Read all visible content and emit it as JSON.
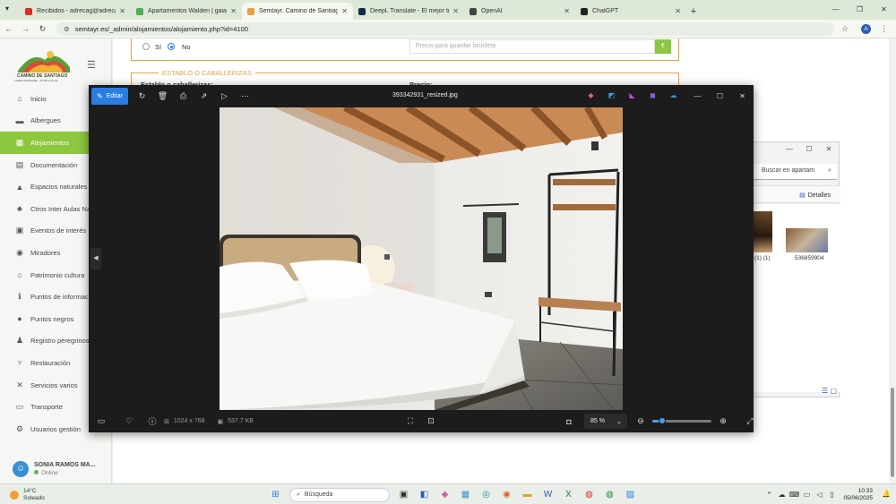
{
  "browser": {
    "tabs": [
      {
        "title": "Recibidos - adrecag@adrecag...",
        "favicon_color": "#d93025",
        "active": false
      },
      {
        "title": "Apartamentos Walden | gaiarec...",
        "favicon_color": "#4caf50",
        "active": false
      },
      {
        "title": "Semtayr. Camino de Santiago. I...",
        "favicon_color": "#e6a23c",
        "active": true
      },
      {
        "title": "DeepL Translate - El mejor tradu...",
        "favicon_color": "#0f2b46",
        "active": false
      },
      {
        "title": "OpenAI",
        "favicon_color": "#444444",
        "active": false
      },
      {
        "title": "ChatGPT",
        "favicon_color": "#222222",
        "active": false
      }
    ],
    "url": "semtayr.es/_admin/alojamientos/alojamiento.php?id=4100",
    "profile_initial": "A"
  },
  "sidebar": {
    "logo_text": "CAMINO DE SANTIAGO",
    "logo_subtext": "CAMINO MOZÁRABE · VÍA DE LA PLATA",
    "items": [
      {
        "label": "Inicio",
        "icon": "home-icon",
        "glyph": "⌂"
      },
      {
        "label": "Albergues",
        "icon": "bed-icon",
        "glyph": "▬"
      },
      {
        "label": "Alojamientos",
        "icon": "building-icon",
        "glyph": "▦",
        "active": true
      },
      {
        "label": "Documentación",
        "icon": "document-icon",
        "glyph": "▤"
      },
      {
        "label": "Espacios naturales",
        "icon": "mountain-icon",
        "glyph": "▲"
      },
      {
        "label": "Ctros Inter Aulas Na",
        "icon": "tree-icon",
        "glyph": "♣"
      },
      {
        "label": "Eventos de interés",
        "icon": "calendar-icon",
        "glyph": "▣"
      },
      {
        "label": "Miradores",
        "icon": "eye-icon",
        "glyph": "◉"
      },
      {
        "label": "Patrimonio cultura",
        "icon": "monument-icon",
        "glyph": "⌂"
      },
      {
        "label": "Puntos de informac",
        "icon": "info-icon",
        "glyph": "ℹ"
      },
      {
        "label": "Puntos negros",
        "icon": "warning-icon",
        "glyph": "●"
      },
      {
        "label": "Registro peregrinos",
        "icon": "pilgrim-icon",
        "glyph": "♟"
      },
      {
        "label": "Restauración",
        "icon": "cutlery-icon",
        "glyph": "♆"
      },
      {
        "label": "Servicios varios",
        "icon": "tools-icon",
        "glyph": "✕"
      },
      {
        "label": "Transporte",
        "icon": "bus-icon",
        "glyph": "▭"
      },
      {
        "label": "Usuarios gestión",
        "icon": "users-icon",
        "glyph": "⚙"
      }
    ],
    "user": {
      "name": "SONIA RAMOS MA...",
      "status": "Online"
    }
  },
  "form": {
    "radio_yes": "Sí",
    "radio_no": "No",
    "price_placeholder": "Precio para guardar bicicleta",
    "euro": "€",
    "section_title": "ESTABLO O CABALLERIZAS",
    "field_label": "Establo o caballerizas:",
    "price_label": "Precio:"
  },
  "viewer": {
    "edit_label": "Editar",
    "filename": "393342931_resized.jpg",
    "dimensions": "1024 x 768",
    "filesize": "537.7 KB",
    "zoom": "85 %",
    "zoom_fraction": 0.17
  },
  "explorer": {
    "search_placeholder": "Buscar en apartam",
    "details_label": "Detalles",
    "file1_label": ") (1) (1)",
    "file2_label": "536859904"
  },
  "taskbar": {
    "weather_temp": "14°C",
    "weather_desc": "Soleado",
    "search_label": "Búsqueda",
    "time": "10:33",
    "date": "05/06/2025"
  }
}
